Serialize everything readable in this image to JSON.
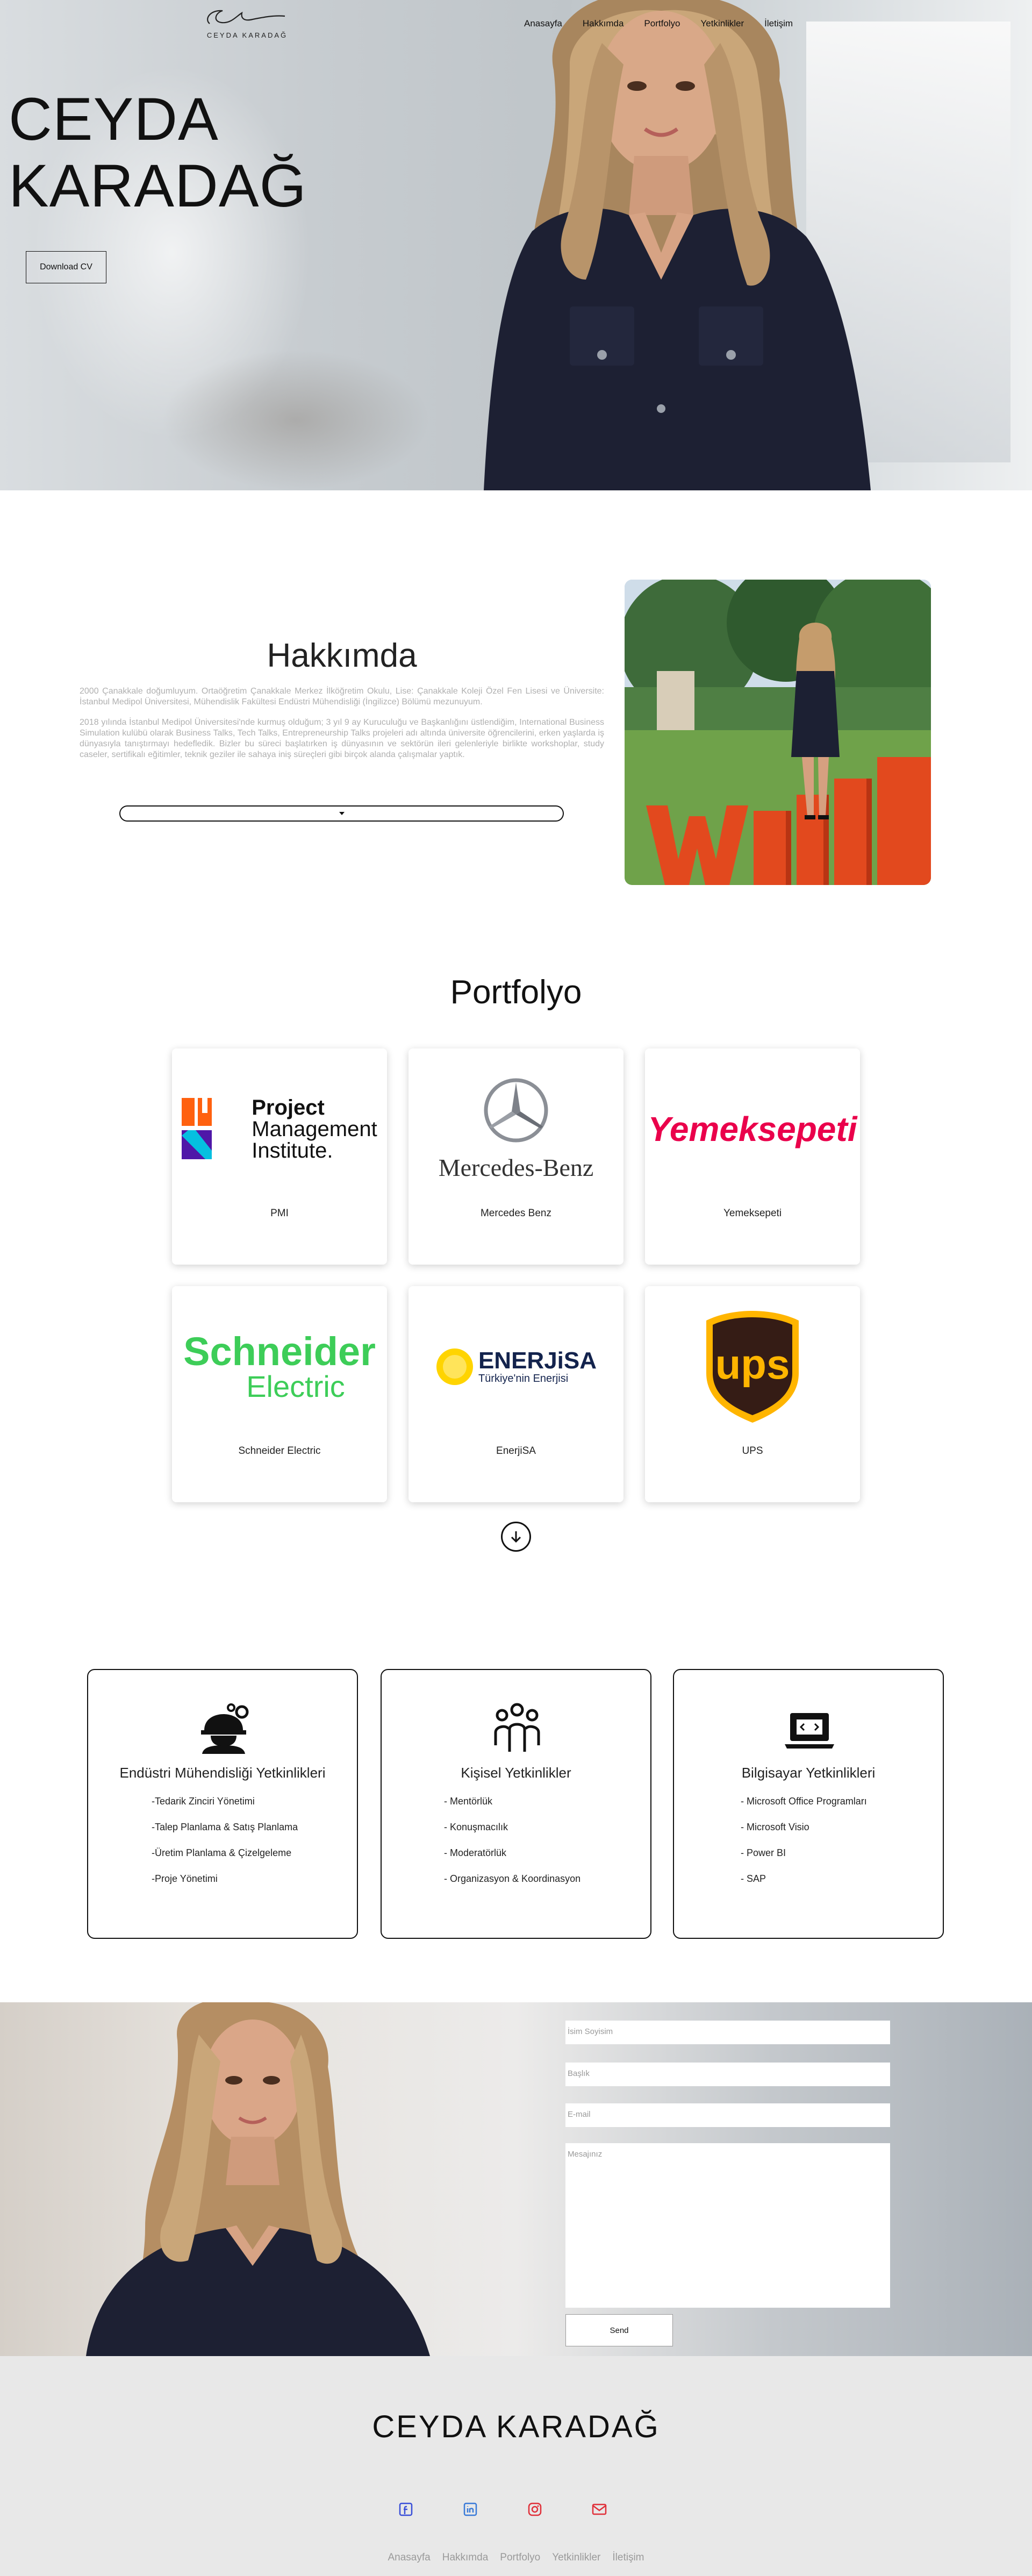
{
  "brand": {
    "logo_text": "CEYDA KARADAĞ"
  },
  "nav": {
    "items": [
      "Anasayfa",
      "Hakkımda",
      "Portfolyo",
      "Yetkinlikler",
      "İletişim"
    ]
  },
  "hero": {
    "title_line1": "CEYDA",
    "title_line2": "KARADAĞ",
    "download_label": "Download CV"
  },
  "about": {
    "title": "Hakkımda",
    "paragraph1": "2000 Çanakkale doğumluyum. Ortaöğretim Çanakkale Merkez İlköğretim Okulu, Lise: Çanakkale Koleji Özel Fen Lisesi ve Üniversite: İstanbul Medipol Üniversitesi, Mühendislik Fakültesi Endüstri Mühendisliği (İngilizce) Bölümü mezunuyum.",
    "paragraph2": "2018 yılında İstanbul Medipol Üniversitesi'nde kurmuş olduğum; 3 yıl 9 ay Kuruculuğu ve Başkanlığını üstlendiğim, International Business Simulation kulübü olarak Business Talks, Tech Talks, Entrepreneurship Talks projeleri adı altında üniversite öğrencilerini, erken yaşlarda iş dünyasıyla tanıştırmayı hedefledik. Bizler bu süreci başlatırken iş dünyasının ve sektörün ileri gelenleriyle birlikte workshoplar, study caseler, sertifikalı eğitimler, teknik geziler ile sahaya iniş süreçleri gibi birçok alanda çalışmalar yaptık.",
    "expand_icon": "caret-down-icon"
  },
  "portfolio": {
    "title": "Portfolyo",
    "items": [
      {
        "caption": "PMI",
        "logo_line1": "Project",
        "logo_line2": "Management",
        "logo_line3": "Institute."
      },
      {
        "caption": "Mercedes Benz",
        "logo_text": "Mercedes-Benz"
      },
      {
        "caption": "Yemeksepeti",
        "logo_text": "Yemeksepeti"
      },
      {
        "caption": "Schneider Electric",
        "logo_line1": "Schneider",
        "logo_line2": "Electric"
      },
      {
        "caption": "EnerjiSA",
        "logo_text": "ENERJiSA",
        "logo_sub": "Türkiye'nin Enerjisi"
      },
      {
        "caption": "UPS",
        "logo_text": "ups"
      }
    ],
    "more_icon": "arrow-down-circle-icon"
  },
  "skills": [
    {
      "title": "Endüstri Mühendisliği Yetkinlikleri",
      "icon": "engineer-gear-icon",
      "items": [
        "-Tedarik Zinciri Yönetimi",
        "-Talep Planlama & Satış Planlama",
        "-Üretim Planlama & Çizelgeleme",
        "-Proje Yönetimi"
      ]
    },
    {
      "title": "Kişisel Yetkinlikler",
      "icon": "team-people-icon",
      "items": [
        "- Mentörlük",
        "- Konuşmacılık",
        "- Moderatörlük",
        "- Organizasyon & Koordinasyon"
      ]
    },
    {
      "title": "Bilgisayar Yetkinlikleri",
      "icon": "laptop-code-icon",
      "items": [
        "- Microsoft Office Programları",
        "- Microsoft Visio",
        "- Power BI",
        "- SAP"
      ]
    }
  ],
  "contact": {
    "name_placeholder": "İsim Soyisim",
    "subject_placeholder": "Başlık",
    "email_placeholder": "E-mail",
    "message_placeholder": "Mesajınız",
    "send_label": "Send"
  },
  "footer": {
    "title": "CEYDA KARADAĞ",
    "social_icons": [
      "facebook-icon",
      "linkedin-icon",
      "instagram-icon",
      "email-icon"
    ],
    "nav": [
      "Anasayfa",
      "Hakkımda",
      "Portfolyo",
      "Yetkinlikler",
      "İletişim"
    ]
  },
  "colors": {
    "accent": "#111111",
    "social": "#3a4fd8",
    "social_alt": "#e0303a",
    "muted": "#9a9a9a"
  }
}
